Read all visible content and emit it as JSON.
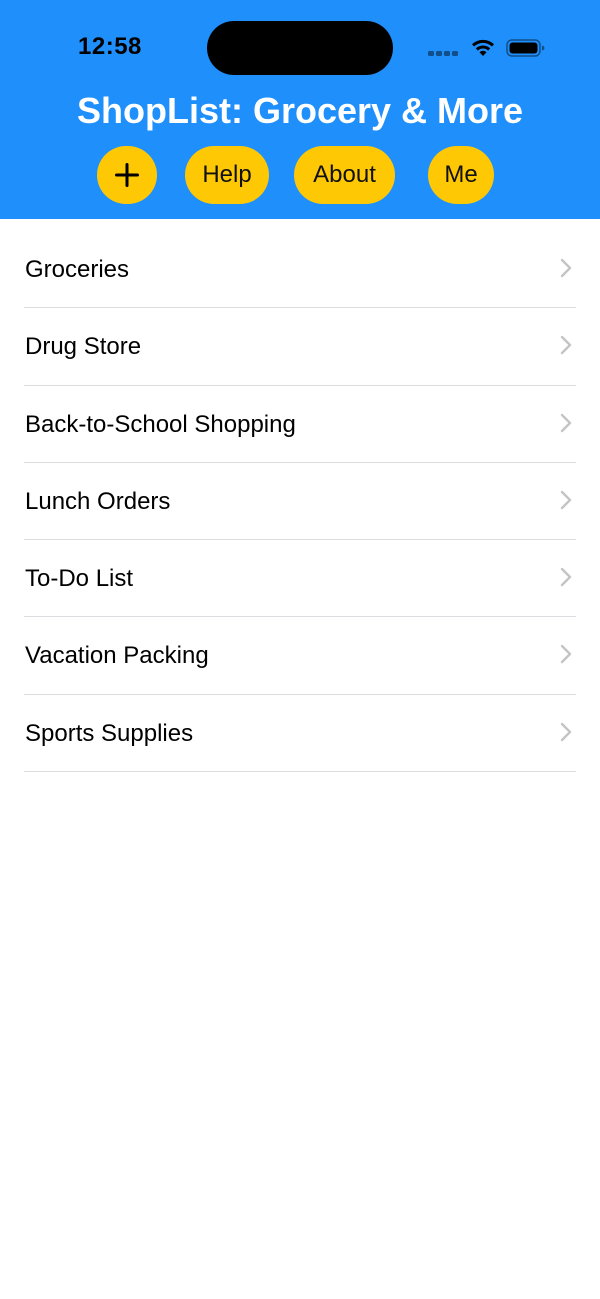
{
  "status_bar": {
    "time": "12:58",
    "icons": [
      "cellular-signal-icon",
      "wifi-icon",
      "battery-icon"
    ]
  },
  "header": {
    "title": "ShopList: Grocery & More",
    "background_color": "#1f8ffb",
    "buttons": {
      "add_label": "+",
      "help_label": "Help",
      "about_label": "About",
      "me_label": "Me"
    },
    "button_color": "#ffc805"
  },
  "lists": {
    "items": [
      {
        "label": "Groceries"
      },
      {
        "label": "Drug Store"
      },
      {
        "label": "Back-to-School Shopping"
      },
      {
        "label": "Lunch Orders"
      },
      {
        "label": "To-Do List"
      },
      {
        "label": "Vacation Packing"
      },
      {
        "label": "Sports Supplies"
      }
    ],
    "row_icon": "chevron-right-icon"
  }
}
